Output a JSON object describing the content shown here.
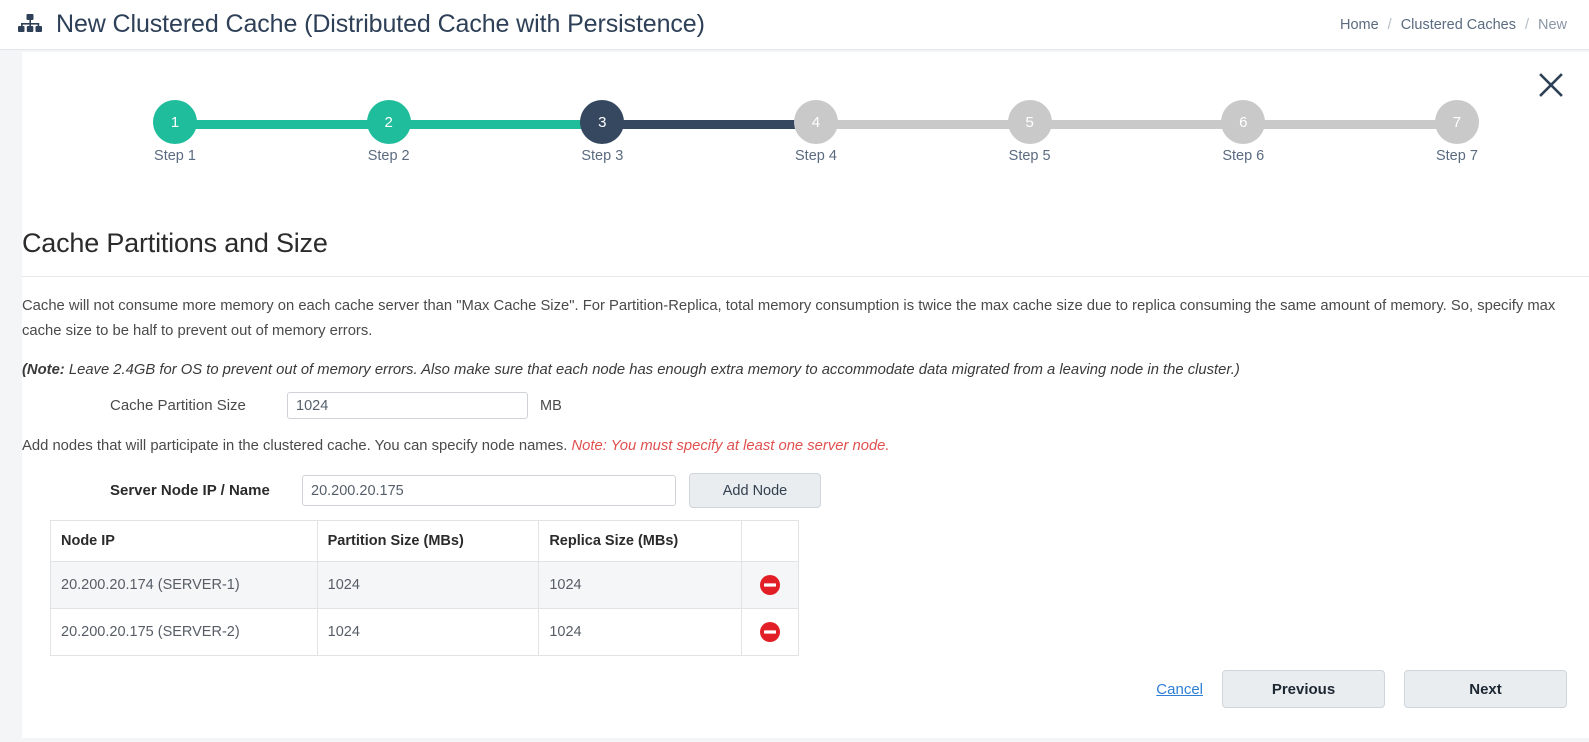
{
  "header": {
    "icon": "sitemap-icon",
    "title": "New Clustered Cache (Distributed Cache with Persistence)",
    "breadcrumb": {
      "home": "Home",
      "section": "Clustered Caches",
      "current": "New",
      "separator": "/"
    },
    "close_icon": "close-icon"
  },
  "stepper": {
    "steps": [
      {
        "number": "1",
        "label": "Step 1",
        "state": "completed"
      },
      {
        "number": "2",
        "label": "Step 2",
        "state": "completed"
      },
      {
        "number": "3",
        "label": "Step 3",
        "state": "active"
      },
      {
        "number": "4",
        "label": "Step 4",
        "state": "upcoming"
      },
      {
        "number": "5",
        "label": "Step 5",
        "state": "upcoming"
      },
      {
        "number": "6",
        "label": "Step 6",
        "state": "upcoming"
      },
      {
        "number": "7",
        "label": "Step 7",
        "state": "upcoming"
      }
    ],
    "segments": [
      "completed",
      "completed",
      "active",
      "upcoming",
      "upcoming",
      "upcoming"
    ],
    "colors": {
      "completed": "#1fbd9c",
      "active": "#35485f",
      "upcoming": "#c9c9c9"
    }
  },
  "main": {
    "section_title": "Cache Partitions and Size",
    "description": "Cache will not consume more memory on each cache server than \"Max Cache Size\". For Partition-Replica, total memory consumption is twice the max cache size due to replica consuming the same amount of memory. So, specify max cache size to be half to prevent out of memory errors.",
    "note_prefix": "(Note:",
    "note_body": " Leave 2.4GB for OS to prevent out of memory errors. Also make sure that each node has enough extra memory to accommodate data migrated from a leaving node in the cluster.)",
    "partition_size": {
      "label": "Cache Partition Size",
      "value": "1024",
      "placeholder": "",
      "unit": "MB"
    },
    "add_nodes_text": "Add nodes that will participate in the clustered cache. You can specify node names. ",
    "add_nodes_warning": "Note: You must specify at least one server node.",
    "warning_color": "#e0504f",
    "server_node": {
      "label": "Server Node IP / Name",
      "value": "20.200.20.175",
      "placeholder": "",
      "add_button": "Add Node"
    },
    "table": {
      "columns": [
        "Node IP",
        "Partition Size (MBs)",
        "Replica Size (MBs)",
        ""
      ],
      "rows": [
        {
          "node_ip": "20.200.20.174 (SERVER-1)",
          "partition_size": "1024",
          "replica_size": "1024",
          "action_icon": "remove-node-icon"
        },
        {
          "node_ip": "20.200.20.175 (SERVER-2)",
          "partition_size": "1024",
          "replica_size": "1024",
          "action_icon": "remove-node-icon"
        }
      ],
      "remove_icon_color": "#e21f26"
    }
  },
  "footer": {
    "cancel": "Cancel",
    "previous": "Previous",
    "next": "Next"
  }
}
